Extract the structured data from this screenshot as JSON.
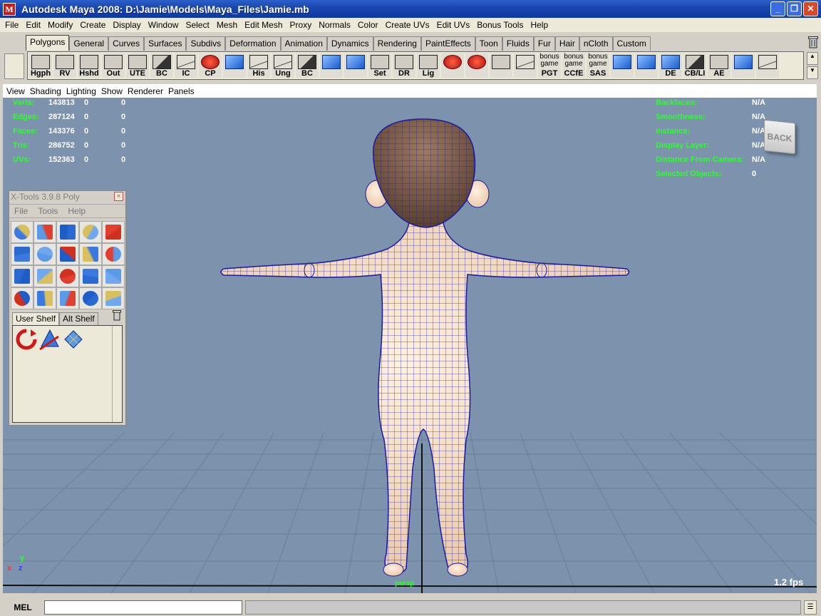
{
  "window": {
    "title": "Autodesk Maya 2008: D:\\Jamie\\Models\\Maya_Files\\Jamie.mb",
    "app_icon": "M"
  },
  "menubar": [
    "File",
    "Edit",
    "Modify",
    "Create",
    "Display",
    "Window",
    "Select",
    "Mesh",
    "Edit Mesh",
    "Proxy",
    "Normals",
    "Color",
    "Create UVs",
    "Edit UVs",
    "Bonus Tools",
    "Help"
  ],
  "shelf": {
    "tabs": [
      "Polygons",
      "General",
      "Curves",
      "Surfaces",
      "Subdivs",
      "Deformation",
      "Animation",
      "Dynamics",
      "Rendering",
      "PaintEffects",
      "Toon",
      "Fluids",
      "Fur",
      "Hair",
      "nCloth",
      "Custom"
    ],
    "active_tab": "Polygons",
    "tools": [
      {
        "label": "Hgph",
        "style": "plain"
      },
      {
        "label": "RV",
        "style": "plain"
      },
      {
        "label": "Hshd",
        "style": "plain"
      },
      {
        "label": "Out",
        "style": "plain"
      },
      {
        "label": "UTE",
        "style": "plain"
      },
      {
        "label": "BC",
        "style": "dark"
      },
      {
        "label": "IC",
        "style": "curve"
      },
      {
        "label": "CP",
        "style": "red"
      },
      {
        "label": "",
        "style": "blue"
      },
      {
        "label": "His",
        "style": "curve"
      },
      {
        "label": "Ung",
        "style": "curve"
      },
      {
        "label": "BC",
        "style": "dark"
      },
      {
        "label": "",
        "style": "blue"
      },
      {
        "label": "",
        "style": "blue"
      },
      {
        "label": "Set",
        "style": "plain"
      },
      {
        "label": "DR",
        "style": "plain"
      },
      {
        "label": "Lig",
        "style": "plain"
      },
      {
        "label": "",
        "style": "red"
      },
      {
        "label": "",
        "style": "red"
      },
      {
        "label": "",
        "style": "plain"
      },
      {
        "label": "",
        "style": "curve"
      },
      {
        "label": "PGT",
        "style": "plain",
        "top": "bonus game"
      },
      {
        "label": "CCfE",
        "style": "plain",
        "top": "bonus game"
      },
      {
        "label": "SAS",
        "style": "plain",
        "top": "bonus game"
      },
      {
        "label": "",
        "style": "blue"
      },
      {
        "label": "",
        "style": "blue"
      },
      {
        "label": "DE",
        "style": "blue"
      },
      {
        "label": "CB/LI",
        "style": "dark"
      },
      {
        "label": "AE",
        "style": "plain"
      },
      {
        "label": "",
        "style": "blue"
      },
      {
        "label": "",
        "style": "curve"
      }
    ]
  },
  "panel_menu": [
    "View",
    "Shading",
    "Lighting",
    "Show",
    "Renderer",
    "Panels"
  ],
  "hud_left": [
    {
      "key": "Verts:",
      "a": "143813",
      "b": "0",
      "c": "0"
    },
    {
      "key": "Edges:",
      "a": "287124",
      "b": "0",
      "c": "0"
    },
    {
      "key": "Faces:",
      "a": "143376",
      "b": "0",
      "c": "0"
    },
    {
      "key": "Tris:",
      "a": "286752",
      "b": "0",
      "c": "0"
    },
    {
      "key": "UVs:",
      "a": "152363",
      "b": "0",
      "c": "0"
    }
  ],
  "hud_right": [
    {
      "key": "Backfaces:",
      "value": "N/A"
    },
    {
      "key": "Smoothness:",
      "value": "N/A"
    },
    {
      "key": "Instance:",
      "value": "N/A"
    },
    {
      "key": "Display Layer:",
      "value": "N/A"
    },
    {
      "key": "Distance From Camera:",
      "value": "N/A"
    },
    {
      "key": "Selected Objects:",
      "value": "0"
    }
  ],
  "viewcube_label": "BACK",
  "axis": {
    "y": "y",
    "x": "x",
    "z": "z"
  },
  "fps": "1.2 fps",
  "camera_label": "persp",
  "xtools": {
    "title": "X-Tools 3.9.8 Poly",
    "close": "×",
    "menu": [
      "File",
      "Tools",
      "Help"
    ],
    "tabs": [
      "User Shelf",
      "Alt Shelf"
    ],
    "active_tab": "User Shelf"
  },
  "commandline": {
    "label": "MEL",
    "value": ""
  },
  "colors": {
    "viewport_bg": "#7d92ad",
    "skin": "#f1d7be",
    "hair": "#7d5e48",
    "wire": "#1a1aa0",
    "hud_green": "#2cff2c"
  }
}
